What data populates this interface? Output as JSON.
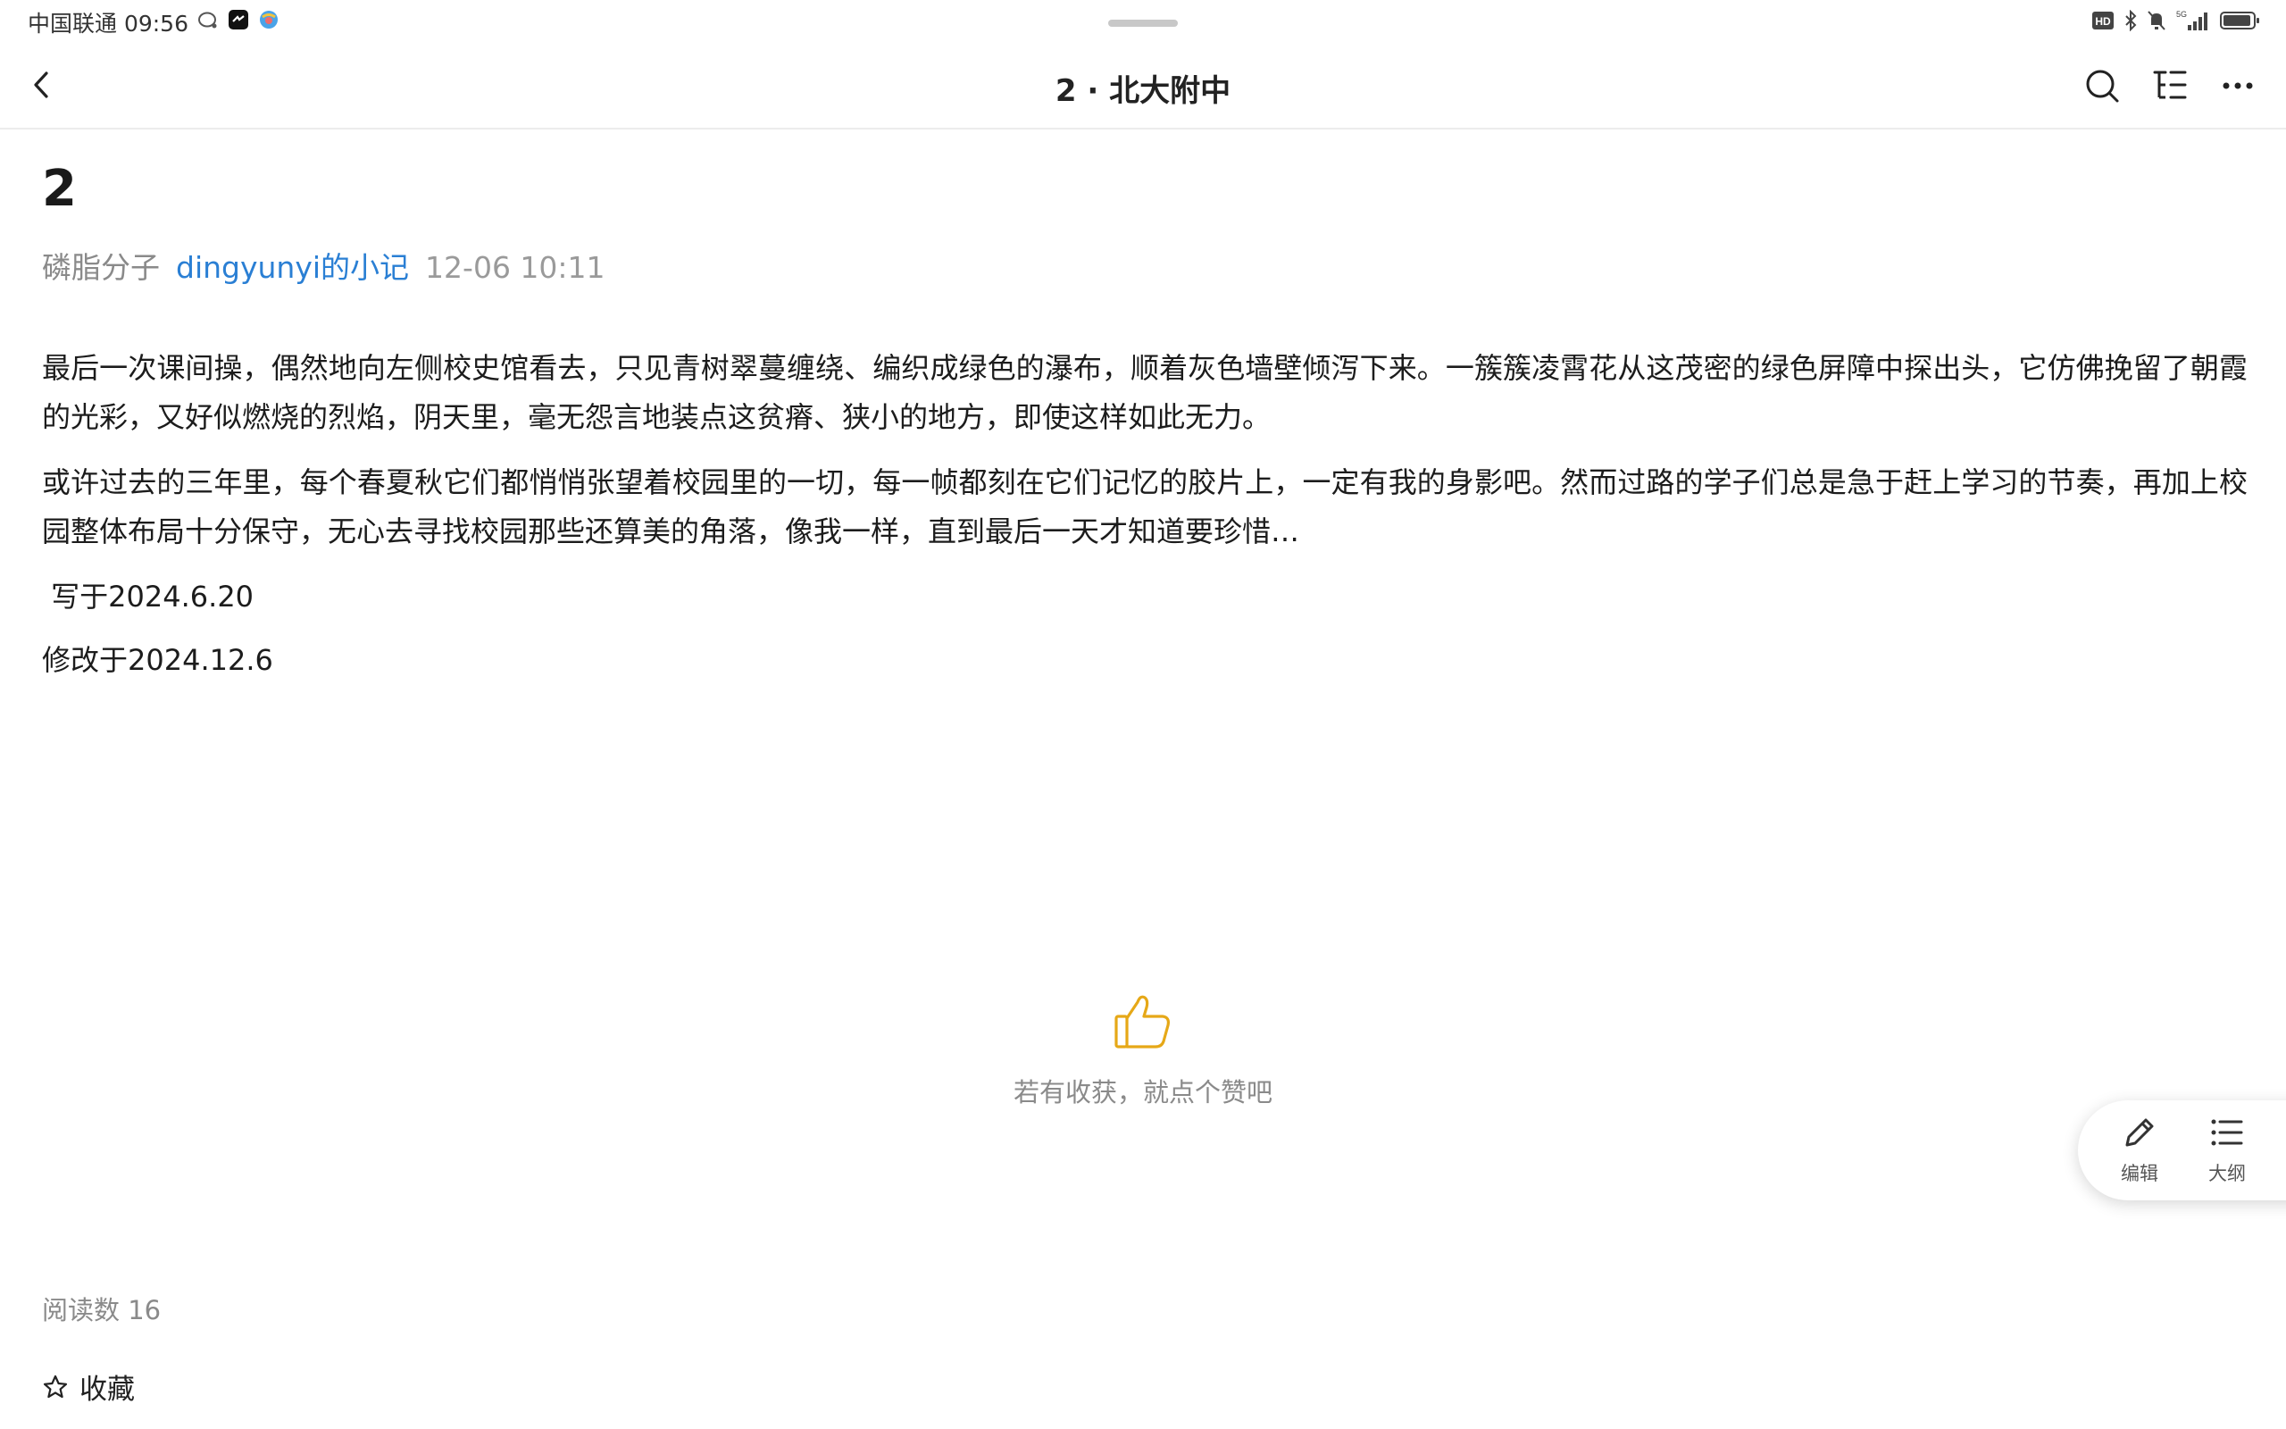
{
  "status_bar": {
    "carrier_time": "中国联通 09:56",
    "network_label": "5G",
    "hd_label": "HD"
  },
  "nav": {
    "title": "2 · 北大附中"
  },
  "article": {
    "title": "2",
    "category": "磷脂分子",
    "author": "dingyunyi的小记",
    "time": "12-06 10:11",
    "paragraphs": [
      "最后一次课间操，偶然地向左侧校史馆看去，只见青树翠蔓缠绕、编织成绿色的瀑布，顺着灰色墙壁倾泻下来。一簇簇凌霄花从这茂密的绿色屏障中探出头，它仿佛挽留了朝霞的光彩，又好似燃烧的烈焰，阴天里，毫无怨言地装点这贫瘠、狭小的地方，即使这样如此无力。",
      "或许过去的三年里，每个春夏秋它们都悄悄张望着校园里的一切，每一帧都刻在它们记忆的胶片上，一定有我的身影吧。然而过路的学子们总是急于赶上学习的节奏，再加上校园整体布局十分保守，无心去寻找校园那些还算美的角落，像我一样，直到最后一天才知道要珍惜…",
      " 写于2024.6.20",
      "修改于2024.12.6"
    ]
  },
  "like": {
    "caption": "若有收获，就点个赞吧",
    "accent_color": "#e6a817"
  },
  "float_panel": {
    "edit_label": "编辑",
    "outline_label": "大纲"
  },
  "footer": {
    "reads": "阅读数 16",
    "favorite_label": "收藏"
  }
}
